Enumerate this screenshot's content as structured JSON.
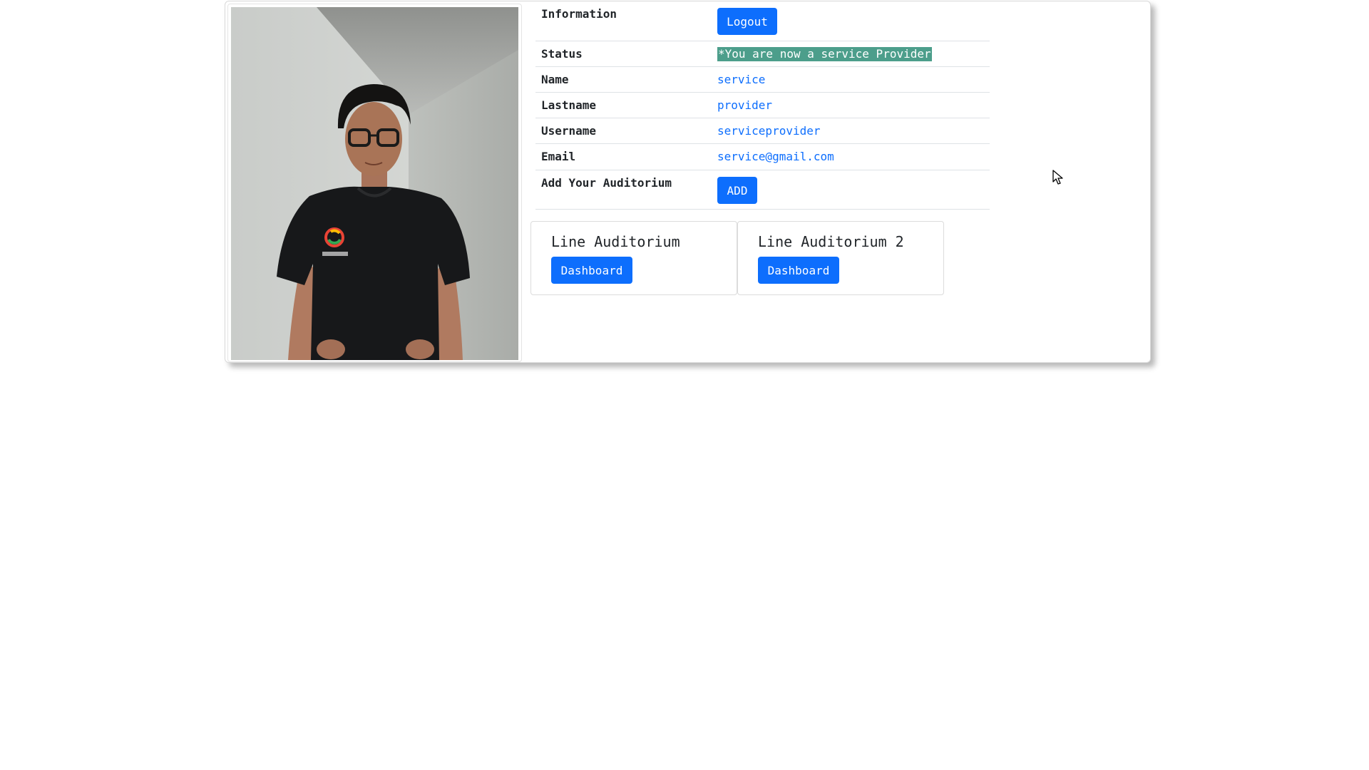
{
  "profile": {
    "photo_icon": "person-photo"
  },
  "info": {
    "header_label": "Information",
    "logout_label": "Logout",
    "rows": [
      {
        "label": "Status",
        "value": "*You are now a service Provider"
      },
      {
        "label": "Name",
        "value": "service"
      },
      {
        "label": "Lastname",
        "value": "provider"
      },
      {
        "label": "Username",
        "value": "serviceprovider"
      },
      {
        "label": "Email",
        "value": "service@gmail.com"
      }
    ],
    "add_label": "Add Your Auditorium",
    "add_button": "ADD"
  },
  "auditoriums": [
    {
      "title": "Line Auditorium",
      "button": "Dashboard"
    },
    {
      "title": "Line Auditorium 2",
      "button": "Dashboard"
    }
  ],
  "colors": {
    "primary": "#0d6efd",
    "status_highlight": "#4c9e8b"
  }
}
